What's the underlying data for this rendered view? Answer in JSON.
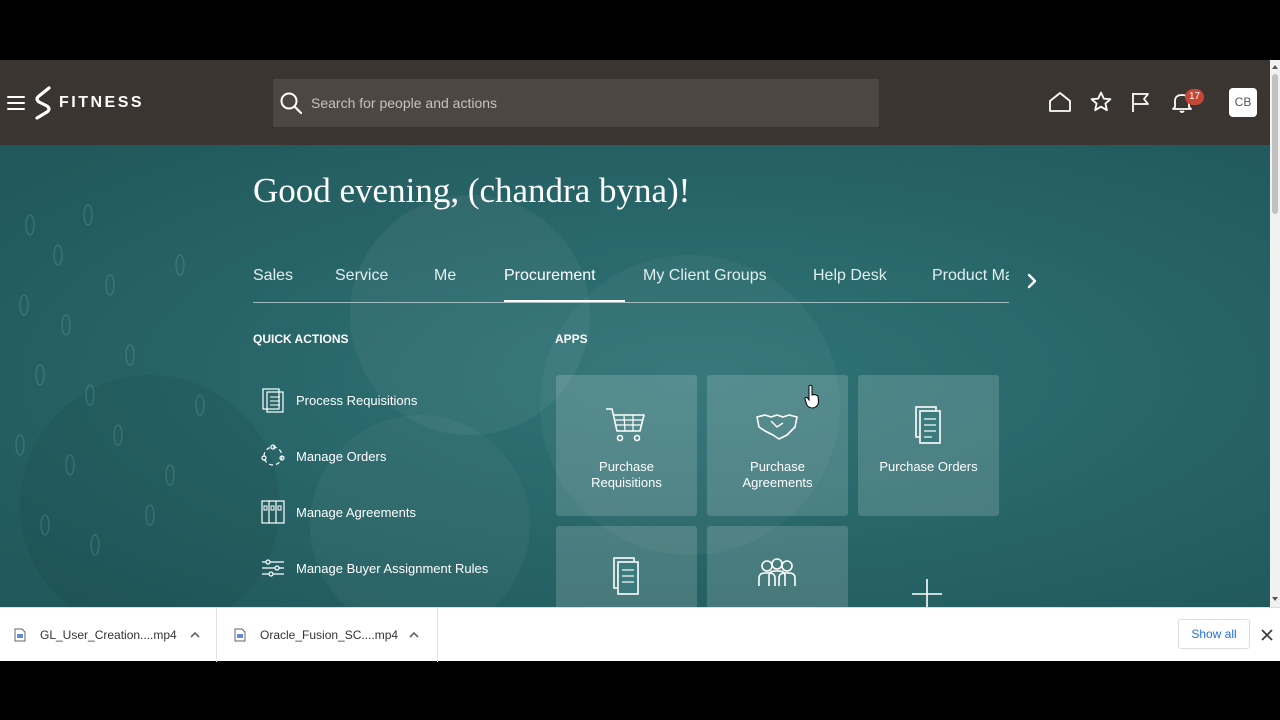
{
  "header": {
    "logo_text": "FITNESS",
    "search_placeholder": "Search for people and actions",
    "notification_count": "17",
    "avatar_initials": "CB"
  },
  "greeting": "Good evening, (chandra byna)!",
  "tabs": [
    {
      "label": "Sales"
    },
    {
      "label": "Service"
    },
    {
      "label": "Me"
    },
    {
      "label": "Procurement",
      "active": true
    },
    {
      "label": "My Client Groups"
    },
    {
      "label": "Help Desk"
    },
    {
      "label": "Product Ma"
    }
  ],
  "quick_actions": {
    "title": "QUICK ACTIONS",
    "items": [
      {
        "label": "Process Requisitions",
        "icon": "requisition-list-icon"
      },
      {
        "label": "Manage Orders",
        "icon": "orders-cycle-icon"
      },
      {
        "label": "Manage Agreements",
        "icon": "agreements-binder-icon"
      },
      {
        "label": "Manage Buyer Assignment Rules",
        "icon": "rules-sliders-icon"
      }
    ]
  },
  "apps": {
    "title": "APPS",
    "tiles": [
      {
        "label": "Purchase Requisitions",
        "icon": "shopping-cart-icon"
      },
      {
        "label": "Purchase Agreements",
        "icon": "handshake-icon"
      },
      {
        "label": "Purchase Orders",
        "icon": "documents-icon"
      },
      {
        "label": "",
        "icon": "document-icon"
      },
      {
        "label": "",
        "icon": "people-group-icon"
      }
    ],
    "add_icon": "plus-icon"
  },
  "downloads": {
    "items": [
      {
        "name": "GL_User_Creation....mp4"
      },
      {
        "name": "Oracle_Fusion_SC....mp4"
      }
    ],
    "show_all": "Show all"
  }
}
